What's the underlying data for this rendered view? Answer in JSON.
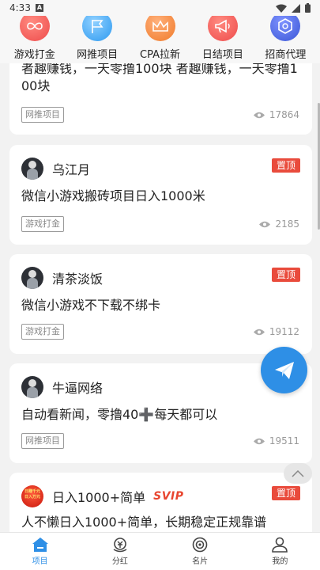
{
  "status_bar": {
    "time": "4:33",
    "badge": "A"
  },
  "categories": [
    {
      "label": "游戏打金",
      "icon": "infinity-icon",
      "color": "#ee4b4b"
    },
    {
      "label": "网推项目",
      "icon": "flag-icon",
      "color": "#2e9af0"
    },
    {
      "label": "CPA拉新",
      "icon": "crown-icon",
      "color": "#f07a2a"
    },
    {
      "label": "日结项目",
      "icon": "megaphone-icon",
      "color": "#ee4b4b"
    },
    {
      "label": "招商代理",
      "icon": "hexagon-icon",
      "color": "#3a56d6"
    }
  ],
  "feed": [
    {
      "title_line1": "者趣赚钱，一天零撸100块 者趣赚钱，一天零撸1",
      "title_line2": "00块",
      "tag": "网推项目",
      "views": "17864"
    },
    {
      "author": "乌江月",
      "badge": "置顶",
      "title": "微信小游戏搬砖项目日入1000米",
      "tag": "游戏打金",
      "views": "2185"
    },
    {
      "author": "清茶淡饭",
      "badge": "置顶",
      "title": "微信小游戏不下载不绑卡",
      "tag": "游戏打金",
      "views": "19112"
    },
    {
      "author": "牛逼网络",
      "title_part1": "自动看新闻，零撸40",
      "title_emoji": "➕",
      "title_part2": "每天都可以",
      "tag": "网推项目",
      "views": "19511"
    },
    {
      "author": "日入1000+简单",
      "avatar_text": "日赚千元\n日入万元",
      "author_tag": "SVIP",
      "badge": "置顶",
      "title": "人不懒日入1000+简单，长期稳定正规靠谱"
    }
  ],
  "tabs": [
    {
      "label": "项目",
      "icon": "home-icon",
      "active": true
    },
    {
      "label": "分红",
      "icon": "dividend-icon",
      "active": false
    },
    {
      "label": "名片",
      "icon": "target-icon",
      "active": false
    },
    {
      "label": "我的",
      "icon": "person-icon",
      "active": false
    }
  ],
  "colors": {
    "accent": "#2e8fe6",
    "badge_red": "#e94b3c",
    "background": "#f2f2f2"
  }
}
